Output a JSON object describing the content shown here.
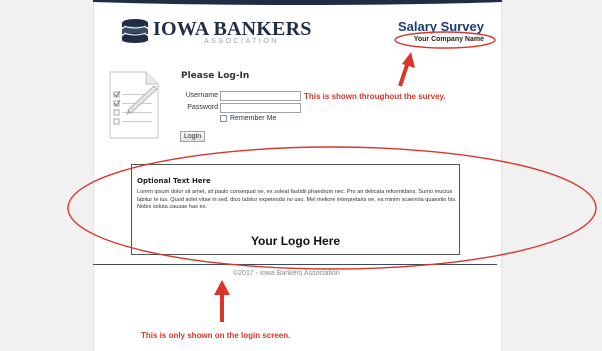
{
  "header": {
    "logo_name": "IOWA BANKERS",
    "logo_sub": "ASSOCIATION",
    "survey_title": "Salary Survey",
    "company_name": "Your Company Name"
  },
  "login": {
    "title": "Please Log-In",
    "username_label": "Username",
    "username_value": "",
    "password_label": "Password",
    "password_value": "",
    "remember_label": "Remember Me",
    "remember_checked": false,
    "button_label": "Login"
  },
  "annotations": {
    "top_note": "This is shown throughout the survey.",
    "bottom_note": "This is only shown on the login screen.",
    "color": "#d9352b"
  },
  "optional": {
    "title": "Optional Text Here",
    "body": "Lorem ipsum dolor sit amet, sit paulo consequat ne, ex soleat fastidii phaedrum nec. Pro an delicata reformidans. Sumo mucius labitur te ius. Quod solet vitae in sed, dico labitur expetenda no usu. Mel meliore interpretaris ne, ea minim scaevola quaestio his. Nobis soluta causae has ex.",
    "logo_placeholder": "Your Logo Here"
  },
  "footer": {
    "text": "©2017 - Iowa Bankers Association"
  },
  "colors": {
    "brand_navy": "#1f2d46",
    "title_blue": "#1c3d7a",
    "annotation_red": "#d9352b"
  }
}
